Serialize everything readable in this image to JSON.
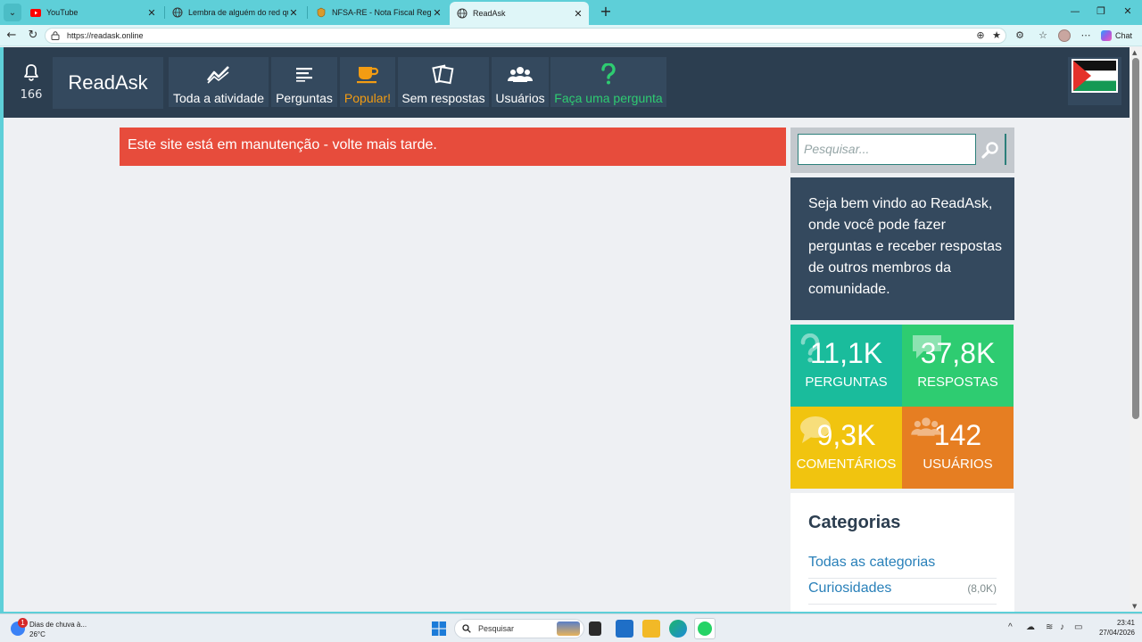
{
  "browser": {
    "tabs": [
      {
        "title": "YouTube",
        "icon": "youtube-icon",
        "active": false
      },
      {
        "title": "Lembra de alguém do red que sur",
        "icon": "globe-icon",
        "active": false
      },
      {
        "title": "NFSA-RE - Nota Fiscal Regime Esp",
        "icon": "nfsa-icon",
        "active": false
      },
      {
        "title": "ReadAsk",
        "icon": "globe-icon",
        "active": true
      }
    ],
    "url": "https://readask.online",
    "chat_label": "Chat"
  },
  "header": {
    "notification_count": "166",
    "brand": "ReadAsk",
    "nav": [
      {
        "label": "Toda a atividade",
        "icon": "activity-chart-icon"
      },
      {
        "label": "Perguntas",
        "icon": "list-lines-icon"
      },
      {
        "label": "Popular!",
        "icon": "coffee-cup-icon"
      },
      {
        "label": "Sem respostas",
        "icon": "papers-icon"
      },
      {
        "label": "Usuários",
        "icon": "users-icon"
      },
      {
        "label": "Faça uma pergunta",
        "icon": "question-mark-icon"
      }
    ],
    "flag": "palestine-flag-icon"
  },
  "alert": {
    "message": "Este site está em manutenção - volte mais tarde."
  },
  "search": {
    "placeholder": "Pesquisar..."
  },
  "welcome": {
    "text": "Seja bem vindo ao ReadAsk, onde você pode fazer perguntas e receber respostas de outros membros da comunidade."
  },
  "stats": [
    {
      "value": "11,1K",
      "label": "PERGUNTAS",
      "color": "#1abc9c"
    },
    {
      "value": "37,8K",
      "label": "RESPOSTAS",
      "color": "#2ecc71"
    },
    {
      "value": "9,3K",
      "label": "COMENTÁRIOS",
      "color": "#f1c40f"
    },
    {
      "value": "142",
      "label": "USUÁRIOS",
      "color": "#e67e22"
    }
  ],
  "categories": {
    "title": "Categorias",
    "items": [
      {
        "name": "Todas as categorias",
        "count": ""
      },
      {
        "name": "Curiosidades",
        "count": "(8,0K)"
      }
    ]
  },
  "taskbar": {
    "weather_title": "Dias de chuva à...",
    "weather_temp": "26°C",
    "weather_badge": "1",
    "search_placeholder": "Pesquisar",
    "time": "23:41",
    "date": "27/04/2026"
  },
  "colors": {
    "header_bg": "#2c3e50",
    "header_item_bg": "#34495e",
    "alert_bg": "#e74c3c",
    "popular": "#f39c12",
    "ask": "#2ecc71",
    "browser_accent": "#5ecfd8"
  }
}
